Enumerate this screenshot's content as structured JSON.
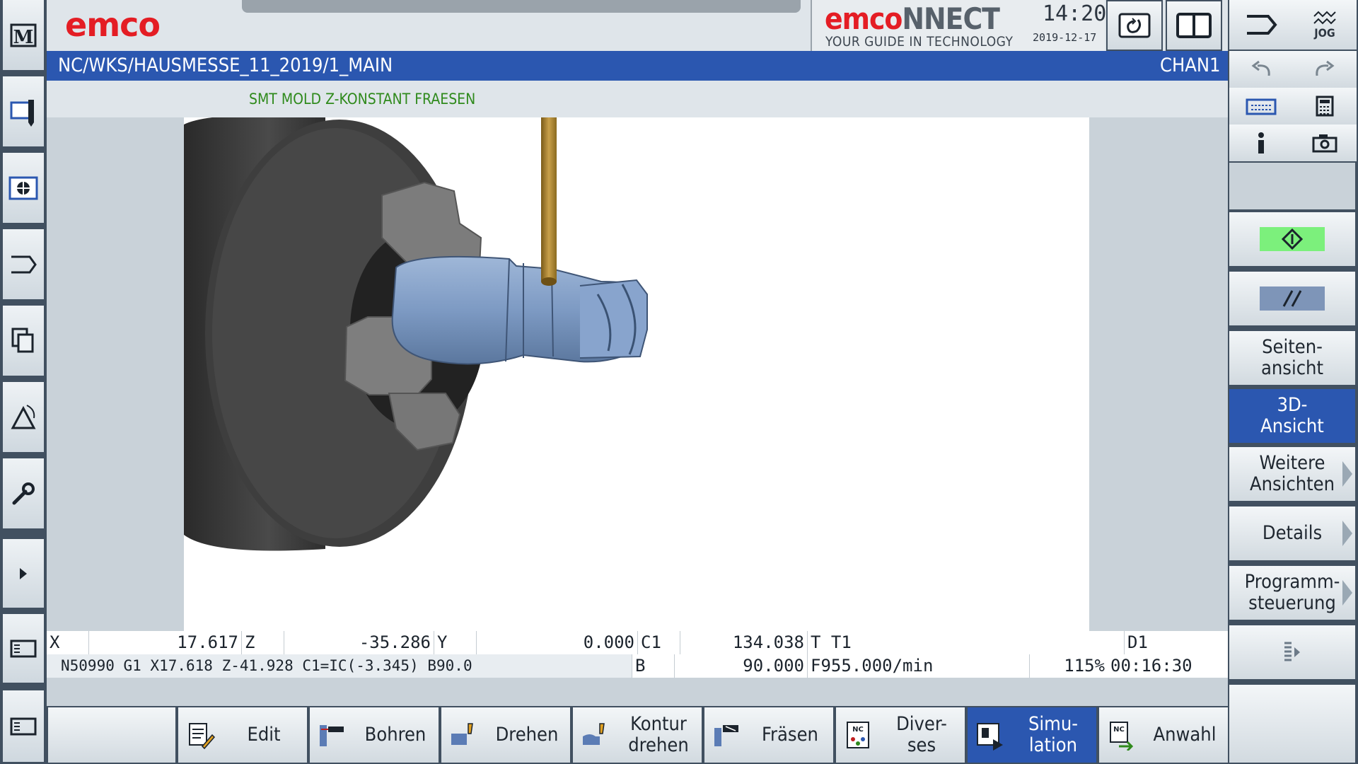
{
  "header": {
    "logo": "emco",
    "emconnect_logo_red": "emco",
    "emconnect_logo_grey": "NNECT",
    "emconnect_tagline": "YOUR GUIDE IN TECHNOLOGY",
    "time": "14:20",
    "date": "2019-12-17",
    "mode_label": "JOG"
  },
  "path": {
    "program": "NC/WKS/HAUSMESSE_11_2019/1_MAIN",
    "channel": "CHAN1",
    "subtitle": "SMT MOLD Z-KONSTANT FRAESEN"
  },
  "status": {
    "x_label": "X",
    "x_value": "17.617",
    "z_label": "Z",
    "z_value": "-35.286",
    "y_label": "Y",
    "y_value": "0.000",
    "c1_label": "C1",
    "c1_value": "134.038",
    "tool": "T T1",
    "d_label": "D1",
    "nc_line": "N50990 G1 X17.618 Z-41.928 C1=IC(-3.345) B90.0",
    "b_label": "B",
    "b_value": "90.000",
    "feed": "F955.000/min",
    "override": "115%",
    "runtime": "00:16:30"
  },
  "right_softkeys": [
    {
      "label": "Seiten-\nansicht"
    },
    {
      "label": "3D-\nAnsicht"
    },
    {
      "label": "Weitere\nAnsichten"
    },
    {
      "label": "Details"
    },
    {
      "label": "Programm-\nsteuerung"
    }
  ],
  "bottom_softkeys": [
    {
      "label": "Edit",
      "icon": "edit-icon"
    },
    {
      "label": "Bohren",
      "icon": "drill-icon"
    },
    {
      "label": "Drehen",
      "icon": "turn-icon"
    },
    {
      "label": "Kontur\ndrehen",
      "icon": "contour-turn-icon"
    },
    {
      "label": "Fräsen",
      "icon": "mill-icon"
    },
    {
      "label": "Diver-\nses",
      "icon": "misc-nc-icon"
    },
    {
      "label": "Simu-\nlation",
      "icon": "simulation-icon"
    },
    {
      "label": "Anwahl",
      "icon": "select-nc-icon"
    }
  ],
  "colors": {
    "accent_blue": "#2b57b0",
    "brand_red": "#e41d24",
    "panel_dark": "#415060",
    "status_green": "#7cf07c"
  }
}
